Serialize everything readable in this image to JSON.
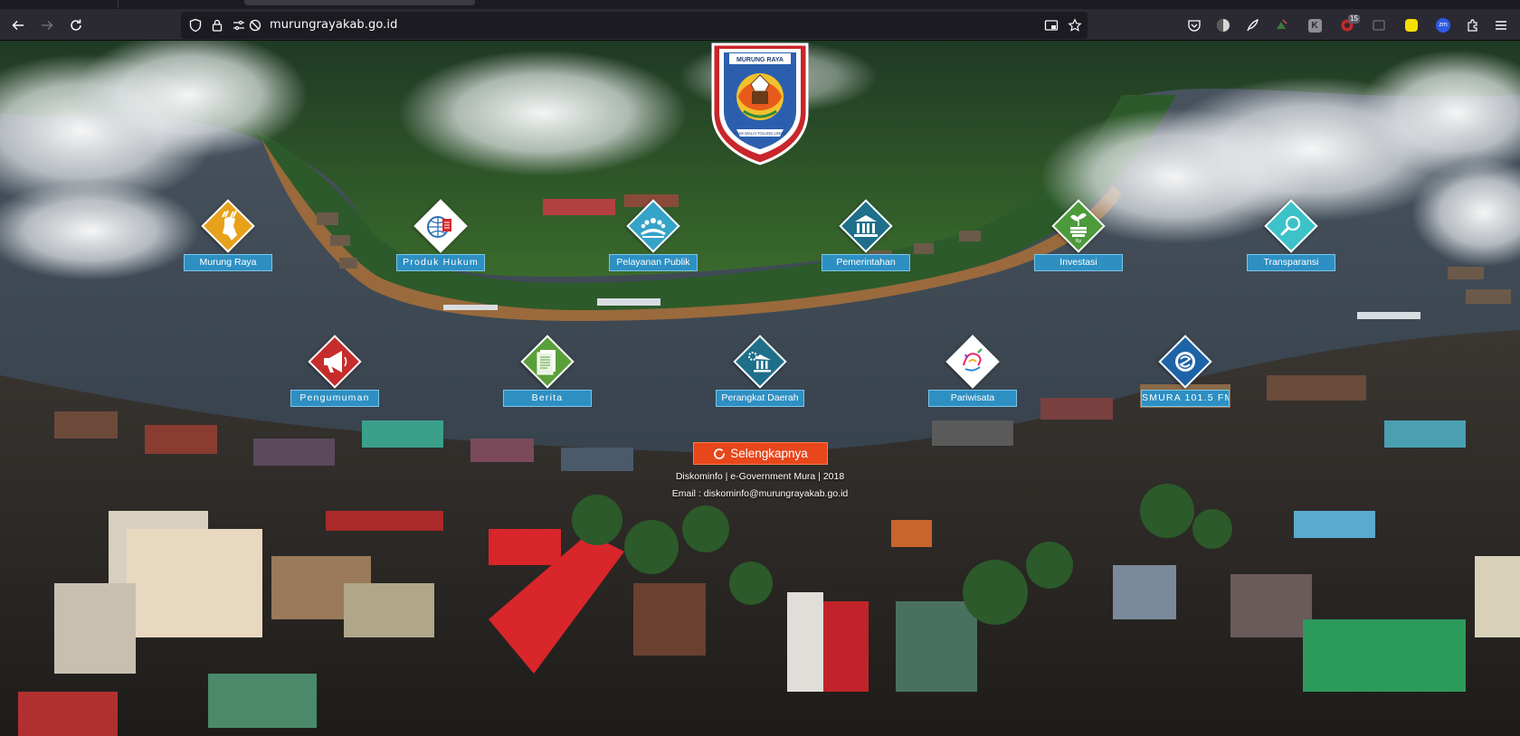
{
  "browser": {
    "url": "murungrayakab.go.id",
    "extensions": [
      {
        "name": "pocket-icon"
      },
      {
        "name": "profile-extension-icon"
      },
      {
        "name": "feather-extension-icon"
      },
      {
        "name": "green-extension-icon"
      },
      {
        "name": "k-extension-icon",
        "text": "K"
      },
      {
        "name": "counter-extension-icon",
        "badge": "15"
      },
      {
        "name": "window-extension-icon"
      },
      {
        "name": "yellow-extension-icon"
      },
      {
        "name": "zoom-extension-icon",
        "text": "zm"
      },
      {
        "name": "extensions-puzzle-icon"
      },
      {
        "name": "hamburger-menu-icon"
      }
    ]
  },
  "site": {
    "logo": {
      "top_text": "MURUNG RAYA",
      "bottom_text": "TANA MALAI TOLUNG LINGU"
    },
    "menu_row1": [
      {
        "label": "Murung Raya",
        "icon": "deer-icon",
        "color": "#e8a11b"
      },
      {
        "label": "Produk Hukum",
        "icon": "globe-document-icon",
        "color": "#ffffff"
      },
      {
        "label": "Pelayanan Publik",
        "icon": "people-service-icon",
        "color": "#36a3c9"
      },
      {
        "label": "Pemerintahan",
        "icon": "government-building-icon",
        "color": "#1e6f8a"
      },
      {
        "label": "Investasi",
        "icon": "investment-plant-icon",
        "color": "#4c9a3a"
      },
      {
        "label": "Transparansi",
        "icon": "magnifier-icon",
        "color": "#3cc2c8"
      }
    ],
    "menu_row2": [
      {
        "label": "Pengumuman",
        "icon": "megaphone-icon",
        "color": "#c62c2c"
      },
      {
        "label": "Berita",
        "icon": "newspaper-icon",
        "color": "#5aa03a"
      },
      {
        "label": "Perangkat Daerah",
        "icon": "regional-office-icon",
        "color": "#1e6f8a"
      },
      {
        "label": "Pariwisata",
        "icon": "tourism-swirl-icon",
        "color": "#ffffff"
      },
      {
        "label": "SMURA 101.5 FM",
        "icon": "radio-logo-icon",
        "color": "#1d63a8"
      }
    ],
    "more_button": "Selengkapnya",
    "footer": {
      "line1": "Diskominfo | e-Government Mura | 2018",
      "line2": "Email : diskominfo@murungrayakab.go.id"
    }
  }
}
